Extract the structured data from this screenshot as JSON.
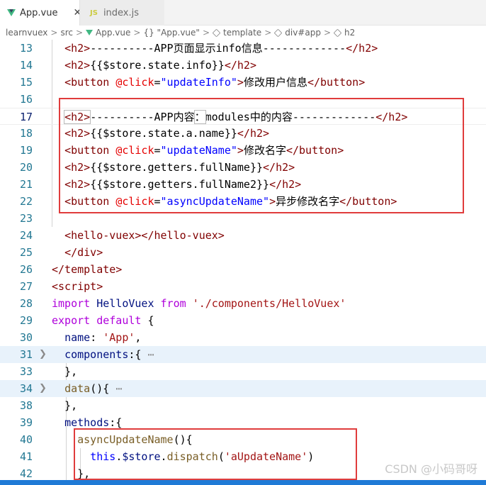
{
  "tabs": [
    {
      "label": "App.vue",
      "close": "✕"
    },
    {
      "label": "index.js",
      "badge": "JS"
    }
  ],
  "breadcrumb": {
    "items": [
      "learnvuex",
      "src",
      "App.vue",
      "{} \"App.vue\"",
      "template",
      "div#app",
      "h2"
    ],
    "separator": ">"
  },
  "lines": [
    {
      "n": "13"
    },
    {
      "n": "14"
    },
    {
      "n": "15"
    },
    {
      "n": "16"
    },
    {
      "n": "17"
    },
    {
      "n": "18"
    },
    {
      "n": "19"
    },
    {
      "n": "20"
    },
    {
      "n": "21"
    },
    {
      "n": "22"
    },
    {
      "n": "23"
    },
    {
      "n": "24"
    },
    {
      "n": "25"
    },
    {
      "n": "26"
    },
    {
      "n": "27"
    },
    {
      "n": "28"
    },
    {
      "n": "29"
    },
    {
      "n": "30"
    },
    {
      "n": "31"
    },
    {
      "n": "33"
    },
    {
      "n": "34"
    },
    {
      "n": "38"
    },
    {
      "n": "39"
    },
    {
      "n": "40"
    },
    {
      "n": "41"
    },
    {
      "n": "42"
    }
  ],
  "code": {
    "l13_text": "----------APP页面显示info信息-------------",
    "l14_expr": "{{$store.state.info}}",
    "l15_attr_val": "\"updateInfo\"",
    "l15_text": "修改用户信息",
    "l17_text_a": "----------APP内容",
    "l17_colon": "：",
    "l17_text_b": "modules中的内容-------------",
    "l18_expr": "{{$store.state.a.name}}",
    "l19_attr_val": "\"updateName\"",
    "l19_text": "修改名字",
    "l20_expr": "{{$store.getters.fullName}}",
    "l21_expr": "{{$store.getters.fullName2}}",
    "l22_attr_val": "\"asyncUpdateName\"",
    "l22_text": "异步修改名字",
    "l28_from_path": "'./components/HelloVuex'",
    "l30_name_val": "'App'",
    "l41_arg": "'aUpdateName'"
  },
  "watermark": "CSDN @小码哥呀",
  "colors": {
    "tag": "#800000",
    "attribute": "#e50000",
    "keyword": "#0000ff",
    "string": "#a31515",
    "highlight_box": "#e03c3c",
    "line_number": "#237893"
  }
}
